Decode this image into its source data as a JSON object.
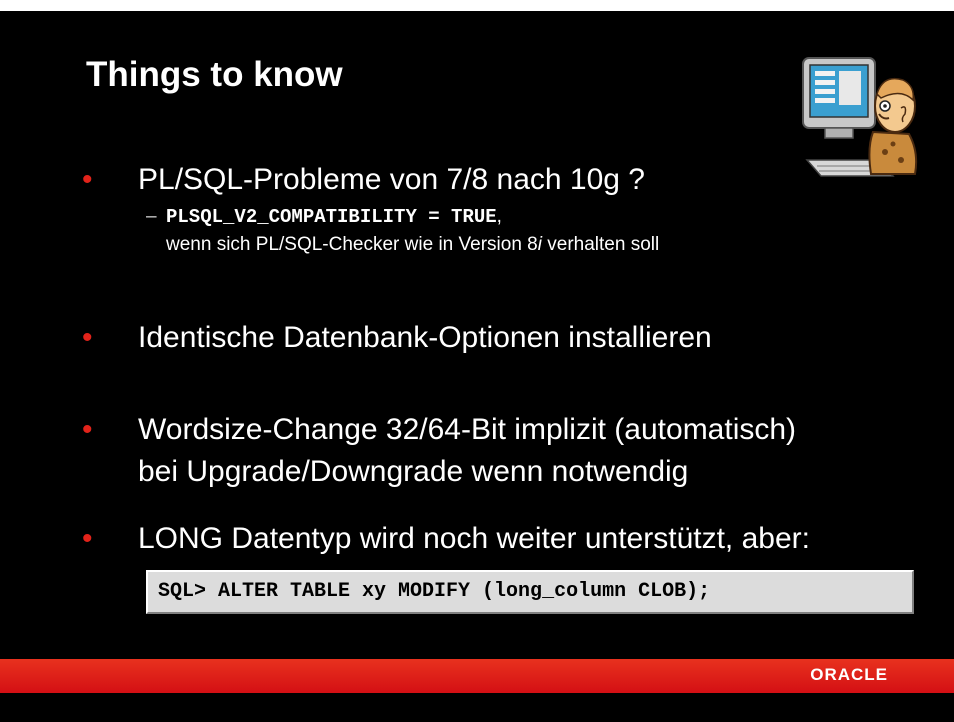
{
  "slide": {
    "title": "Things to know",
    "bullets": [
      {
        "marker": "•",
        "lines": [
          "PL/SQL-Probleme von 7/8 nach 10g ?"
        ]
      },
      {
        "marker": "•",
        "lines": [
          "Identische Datenbank-Optionen installieren"
        ]
      },
      {
        "marker": "•",
        "lines": [
          "Wordsize-Change 32/64-Bit implizit (automatisch)",
          "bei Upgrade/Downgrade wenn notwendig"
        ]
      },
      {
        "marker": "•",
        "lines": [
          "LONG Datentyp wird noch weiter unterstützt, aber:"
        ]
      }
    ],
    "sub_bullet": {
      "marker": "–",
      "code": "PLSQL_V2_COMPATIBILITY = TRUE",
      "code_suffix": ",",
      "line2_before": "wenn sich PL/SQL-Checker wie in Version 8",
      "line2_italic": "i",
      "line2_after": " verhalten soll"
    },
    "code_example": "SQL> ALTER TABLE xy MODIFY (long_column CLOB);",
    "footer": {
      "logo_text": "ORACLE"
    },
    "colors": {
      "background": "#000000",
      "bullet": "#e2231a",
      "footer_bar": "#d40f14",
      "code_box": "#dcdcdc"
    },
    "icons": {
      "clipart": "person-at-computer-illustration"
    }
  }
}
